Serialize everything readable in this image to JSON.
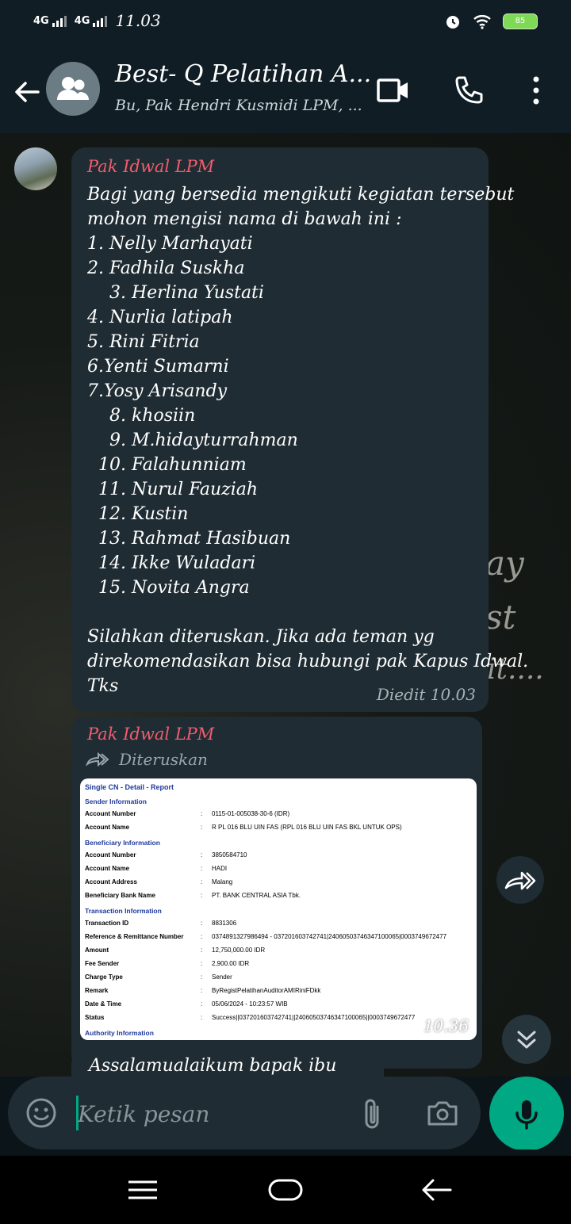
{
  "status_bar": {
    "signal_1": "4G",
    "signal_2": "4G",
    "time": "11.03",
    "battery_level": "85",
    "icons": [
      "alarm-icon",
      "wifi-icon",
      "battery-icon"
    ]
  },
  "header": {
    "title": "Best- Q Pelatihan A...",
    "subtitle": "Bu, Pak Hendri Kusmidi LPM, ...",
    "icons": [
      "back-arrow-icon",
      "group-avatar-icon",
      "video-call-icon",
      "voice-call-icon",
      "more-options-icon"
    ]
  },
  "wallpaper_text": [
    "ay",
    "st",
    "it...."
  ],
  "messages": [
    {
      "sender": "Pak Idwal LPM",
      "lines": [
        "Bagi yang bersedia mengikuti kegiatan tersebut",
        "mohon mengisi nama di bawah ini :",
        "1. Nelly Marhayati",
        "2. Fadhila Suskha",
        "    3. Herlina Yustati",
        "4. Nurlia latipah",
        "5. Rini Fitria",
        "6.Yenti Sumarni",
        "7.Yosy Arisandy",
        "    8. khosiin",
        "    9. M.hidayturrahman",
        "  10. Falahunniam",
        "  11. Nurul Fauziah",
        "  12. Kustin",
        "  13. Rahmat Hasibuan",
        "  14. Ikke Wuladari",
        "  15. Novita Angra",
        "",
        "Silahkan diteruskan. Jika ada teman yg",
        "direkomendasikan bisa hubungi pak Kapus Idwal.",
        "Tks"
      ],
      "meta": "Diedit 10.03"
    },
    {
      "sender": "Pak Idwal LPM",
      "forwarded_label": "Diteruskan",
      "time": "10.36",
      "receipt": {
        "title": "Single CN - Detail - Report",
        "sender_section": "Sender Information",
        "sender_rows": [
          {
            "k": "Account Number",
            "v": "0115-01-005038-30-6 (IDR)"
          },
          {
            "k": "Account Name",
            "v": "R PL 016 BLU UIN FAS (RPL 016 BLU UIN FAS BKL UNTUK OPS)"
          }
        ],
        "beneficiary_section": "Beneficiary Information",
        "beneficiary_rows": [
          {
            "k": "Account Number",
            "v": "3850584710"
          },
          {
            "k": "Account Name",
            "v": "HADI"
          },
          {
            "k": "Account Address",
            "v": "Malang"
          },
          {
            "k": "Beneficiary Bank Name",
            "v": "PT. BANK CENTRAL ASIA Tbk."
          }
        ],
        "transaction_section": "Transaction Information",
        "transaction_rows": [
          {
            "k": "Transaction ID",
            "v": "8831306"
          },
          {
            "k": "Reference & Remittance Number",
            "v": "0374891327986494 - 037201603742741|2406050374634710006​5|0003749672477"
          },
          {
            "k": "Amount",
            "v": "12,750,000.00 IDR"
          },
          {
            "k": "Fee Sender",
            "v": "2,900.00 IDR"
          },
          {
            "k": "Charge Type",
            "v": "Sender"
          },
          {
            "k": "Remark",
            "v": "ByRegistPelatihanAuditorAMIRiniFDkk"
          },
          {
            "k": "Date & Time",
            "v": "05/06/2024 - 10:23:57 WIB"
          },
          {
            "k": "Status",
            "v": "Success||037201603742741||24060503746347100065||0003749672477"
          }
        ],
        "authority_section": "Authority Information"
      }
    },
    {
      "peek_text": "Assalamualaikum bapak ibu"
    }
  ],
  "composer": {
    "placeholder": "Ketik pesan",
    "icons": [
      "emoji-icon",
      "attach-icon",
      "camera-icon",
      "mic-icon"
    ]
  },
  "nav_bar": {
    "icons": [
      "menu-icon",
      "home-icon",
      "back-icon"
    ]
  }
}
